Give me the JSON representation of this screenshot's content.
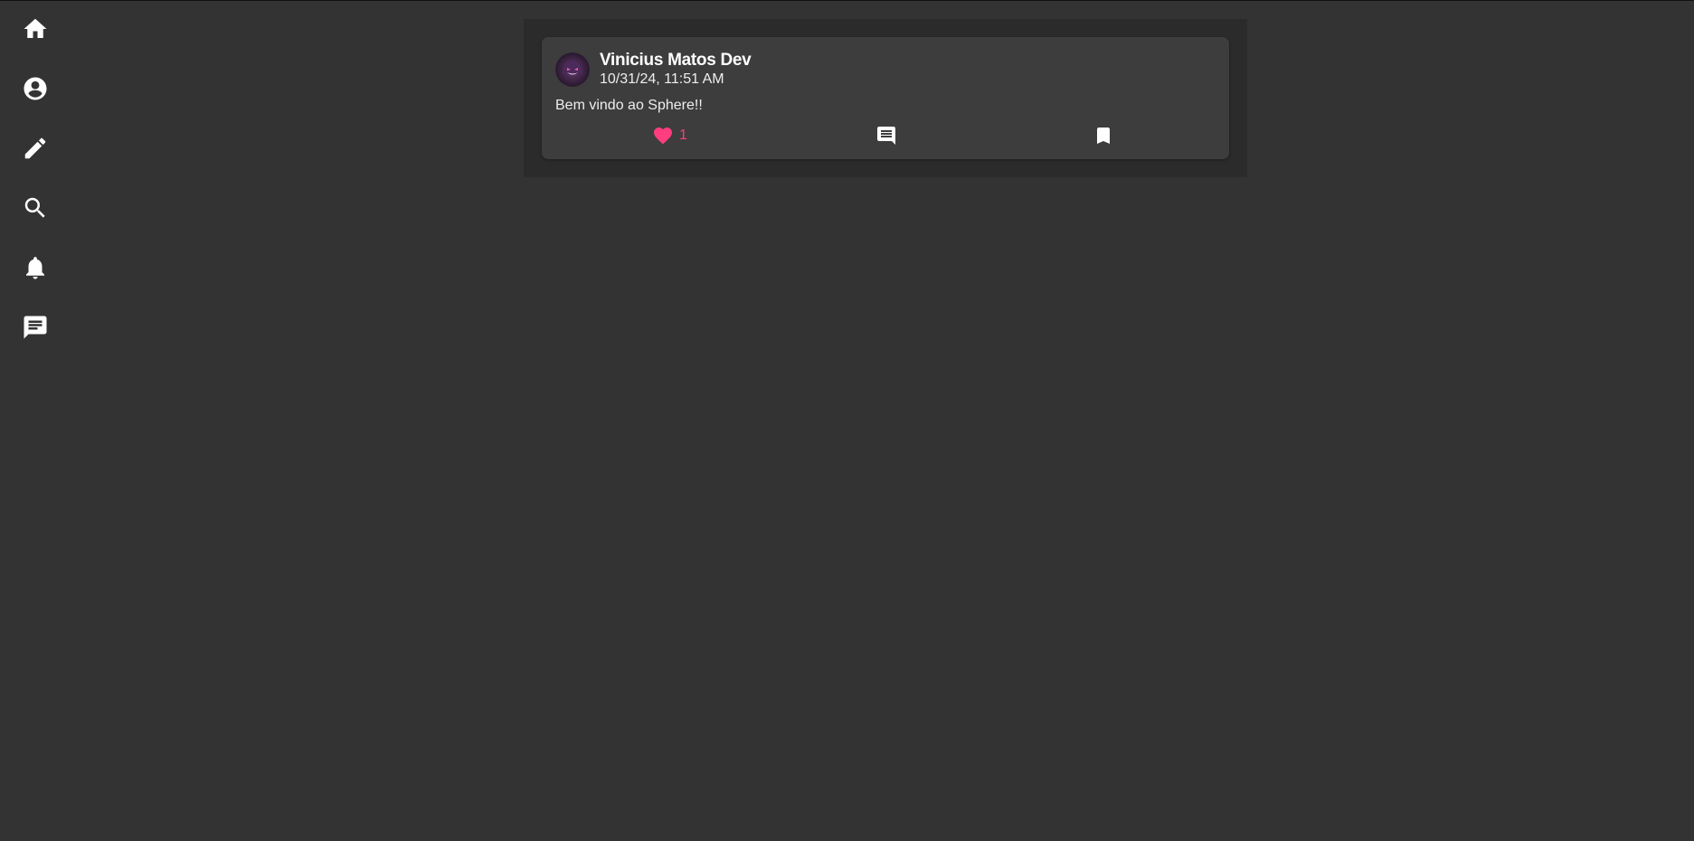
{
  "sidebar": {
    "items": [
      {
        "icon": "home-icon",
        "label": "Home"
      },
      {
        "icon": "account-icon",
        "label": "Profile"
      },
      {
        "icon": "pencil-icon",
        "label": "Create post"
      },
      {
        "icon": "search-icon",
        "label": "Search"
      },
      {
        "icon": "bell-icon",
        "label": "Notifications"
      },
      {
        "icon": "message-icon",
        "label": "Messages"
      }
    ]
  },
  "post": {
    "author": "Vinicius Matos Dev",
    "timestamp": "10/31/24, 11:51 AM",
    "content": "Bem vindo ao Sphere!!",
    "likes": "1",
    "liked": true
  },
  "colors": {
    "background": "#333333",
    "feed_background": "#2b2b2b",
    "card_background": "#3d3d3d",
    "like_accent": "#ff3d7f",
    "icon": "#ffffff"
  }
}
